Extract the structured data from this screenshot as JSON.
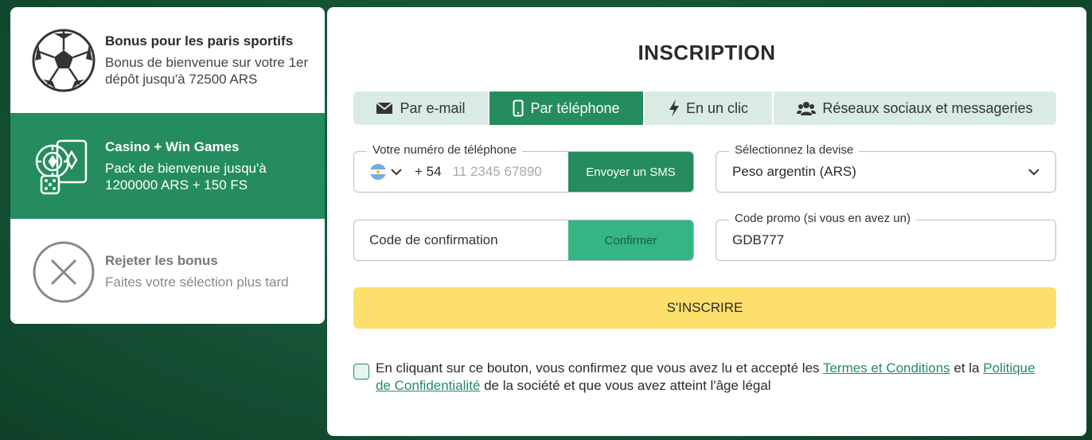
{
  "bonuses": [
    {
      "title": "Bonus pour les paris sportifs",
      "desc": "Bonus de bienvenue sur votre 1er dépôt jusqu'à 72500 ARS",
      "icon": "soccer-ball-icon"
    },
    {
      "title": "Casino + Win Games",
      "desc": "Pack de bienvenue jusqu'à 1200000 ARS + 150 FS",
      "icon": "casino-chips-cards-icon",
      "selected": true
    },
    {
      "title": "Rejeter les bonus",
      "desc": "Faites votre sélection plus tard",
      "icon": "close-circle-icon"
    }
  ],
  "form": {
    "title": "INSCRIPTION",
    "tabs": [
      {
        "label": "Par e-mail",
        "icon": "envelope-icon"
      },
      {
        "label": "Par téléphone",
        "icon": "phone-icon",
        "active": true
      },
      {
        "label": "En un clic",
        "icon": "lightning-icon"
      },
      {
        "label": "Réseaux sociaux et messageries",
        "icon": "users-icon"
      }
    ],
    "phone": {
      "label": "Votre numéro de téléphone",
      "prefix": "+ 54",
      "placeholder": "11 2345 67890",
      "button": "Envoyer un SMS",
      "flag": "argentina-flag-icon"
    },
    "currency": {
      "label": "Sélectionnez la devise",
      "value": "Peso argentin (ARS)"
    },
    "confirmation": {
      "placeholder": "Code de confirmation",
      "button": "Confirmer"
    },
    "promo": {
      "label": "Code promo (si vous en avez un)",
      "value": "GDB777"
    },
    "submit": "S'INSCRIRE",
    "terms": {
      "before": "En cliquant sur ce bouton, vous confirmez que vous avez lu et accepté les ",
      "link1": "Termes et Conditions",
      "middle": " et la ",
      "link2": "Politique de Confidentialité",
      "after": " de la société et que vous avez atteint l'âge légal"
    }
  },
  "colors": {
    "brand": "#248c5e",
    "submit": "#fde06c",
    "tab_bg": "#d9ebe3"
  }
}
